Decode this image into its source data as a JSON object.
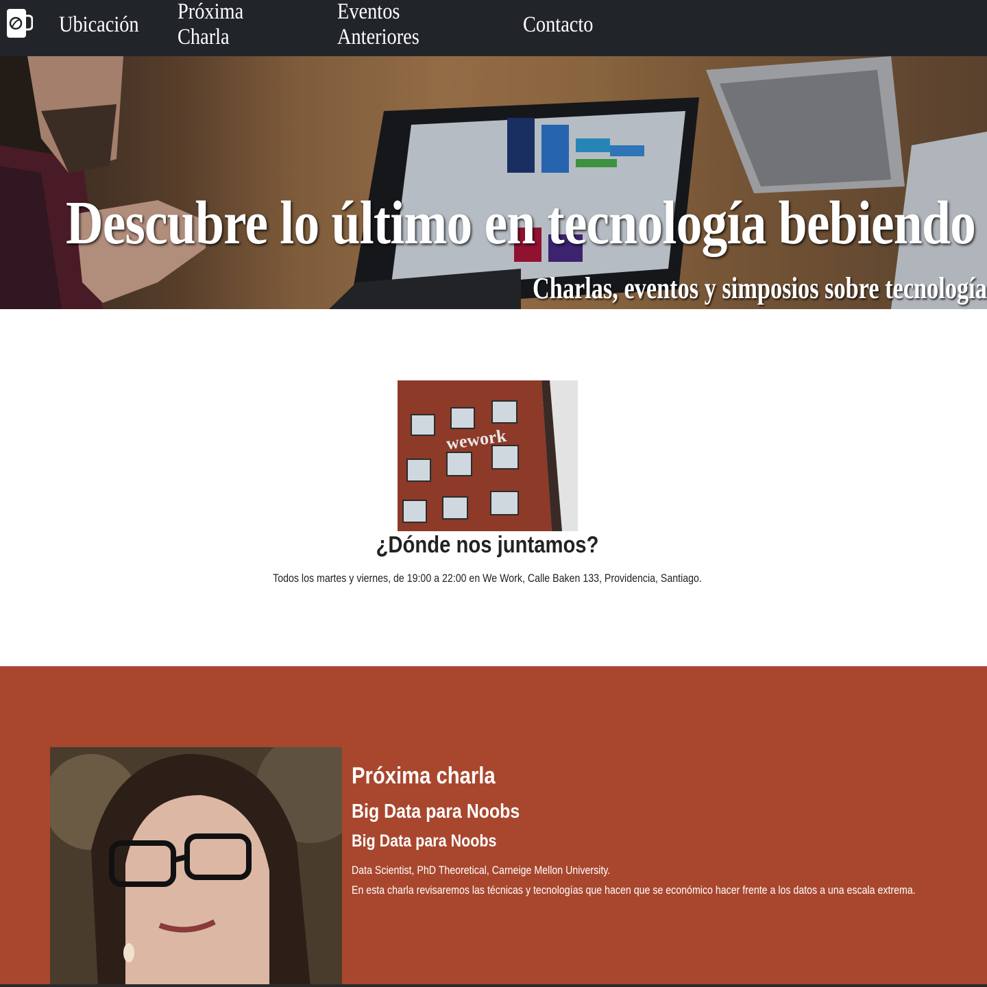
{
  "nav": {
    "items": [
      {
        "label": "Ubicación"
      },
      {
        "label": "Próxima Charla"
      },
      {
        "label": "Eventos Anteriores"
      },
      {
        "label": "Contacto"
      }
    ]
  },
  "hero": {
    "title": "Descubre lo último en tecnología bebiendo café",
    "subtitle": "Charlas, eventos y simposios sobre tecnología"
  },
  "location": {
    "photo_sign": "wework",
    "title": "¿Dónde nos juntamos?",
    "text": "Todos los martes y viernes, de 19:00 a 22:00 en We Work, Calle Baken 133, Providencia, Santiago."
  },
  "next_talk": {
    "heading": "Próxima charla",
    "title": "Big Data para Noobs",
    "subtitle": "Big Data para Noobs",
    "speaker": "Data Scientist, PhD Theoretical, Carneige Mellon University.",
    "description": "En esta charla revisaremos las técnicas y tecnologías que hacen que se económico hacer frente a los datos a una escala extrema."
  },
  "colors": {
    "navbar": "#212529",
    "talk_section": "#a8472e",
    "text_light": "#ffffff",
    "text_dark": "#222222"
  }
}
